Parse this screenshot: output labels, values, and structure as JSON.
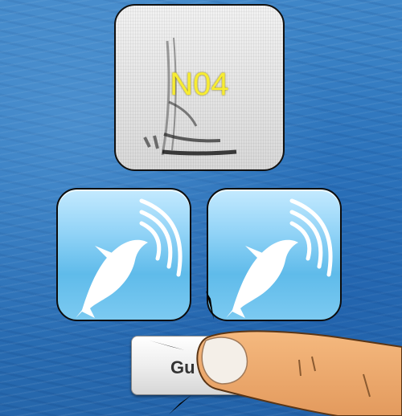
{
  "spectrogram_card": {
    "label": "N04",
    "icon": "spectrogram-icon"
  },
  "whale_buttons": [
    {
      "icon": "whale-sound-icon"
    },
    {
      "icon": "whale-sound-icon"
    }
  ],
  "guess_button": {
    "label": "Gu"
  },
  "overlay": {
    "icon": "pointing-finger-icon"
  },
  "colors": {
    "label_yellow": "#f7ec32",
    "button_blue": "#5fbbea",
    "ocean": "#2f78bf"
  }
}
